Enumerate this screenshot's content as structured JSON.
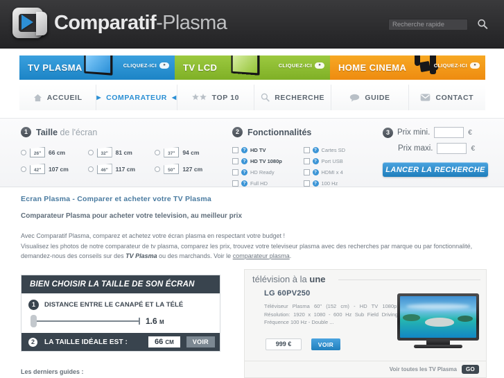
{
  "header": {
    "logo_primary": "Comparatif",
    "logo_secondary": "-Plasma",
    "logo_icon": "cp-play-logo",
    "search_placeholder": "Recherche rapide",
    "search_value": "",
    "search_icon": "search-icon"
  },
  "categories": [
    {
      "label": "TV PLASMA",
      "cta": "CLIQUEZ-ICI",
      "badge": "»",
      "color": "#2d90d5"
    },
    {
      "label": "TV LCD",
      "cta": "CLIQUEZ-ICI",
      "badge": "»",
      "color": "#8fbe31"
    },
    {
      "label": "HOME CINEMA",
      "cta": "CLIQUEZ-ICI",
      "badge": "»",
      "color": "#f29518"
    }
  ],
  "nav": [
    {
      "label": "ACCUEIL",
      "icon": "home-icon",
      "active": false
    },
    {
      "label": "COMPARATEUR",
      "icon": "arrows",
      "active": true
    },
    {
      "label": "TOP 10",
      "icon": "stars-icon",
      "active": false
    },
    {
      "label": "RECHERCHE",
      "icon": "search-icon",
      "active": false
    },
    {
      "label": "GUIDE",
      "icon": "speech-bubble-icon",
      "active": false
    },
    {
      "label": "CONTACT",
      "icon": "envelope-icon",
      "active": false
    }
  ],
  "filters": {
    "step1": {
      "number": "1",
      "title_bold": "Taille",
      "title_rest": " de l'écran",
      "sizes": [
        {
          "inches": "26ʺ",
          "cm": "66 cm"
        },
        {
          "inches": "32ʺ",
          "cm": "81 cm"
        },
        {
          "inches": "37ʺ",
          "cm": "94 cm"
        },
        {
          "inches": "42ʺ",
          "cm": "107 cm"
        },
        {
          "inches": "46ʺ",
          "cm": "117 cm"
        },
        {
          "inches": "50ʺ",
          "cm": "127 cm"
        }
      ]
    },
    "step2": {
      "number": "2",
      "title": "Fonctionnalités",
      "features": [
        {
          "label": "HD TV",
          "bold": true
        },
        {
          "label": "Cartes SD",
          "bold": false
        },
        {
          "label": "HD TV 1080p",
          "bold": true
        },
        {
          "label": "Port USB",
          "bold": false
        },
        {
          "label": "HD Ready",
          "bold": false
        },
        {
          "label": "HDMI x 4",
          "bold": false
        },
        {
          "label": "Full HD",
          "bold": false
        },
        {
          "label": "100 Hz",
          "bold": false
        }
      ]
    },
    "step3": {
      "number": "3",
      "min_label": "Prix mini.",
      "min_value": "",
      "max_label": "Prix maxi.",
      "max_value": "",
      "currency": "€",
      "submit_label": "LANCER LA RECHERCHE"
    }
  },
  "article": {
    "heading": "Ecran Plasma - Comparer et acheter votre TV Plasma",
    "subheading": "Comparateur Plasma pour acheter votre television, au meilleur prix",
    "p1": "Avec Comparatif Plasma, comparez et achetez votre écran plasma en respectant votre budget !",
    "p2_a": "Visualisez les photos de notre comparateur de tv plasma, comparez les prix, trouvez votre televiseur plasma avec des recherches par marque ou par fonctionnalité, demandez-nous des conseils sur des ",
    "p2_bold": "TV Plasma",
    "p2_b": " ou des marchands. Voir le ",
    "p2_link": "comparateur plasma",
    "p2_end": "."
  },
  "guide": {
    "title": "BIEN CHOISIR LA TAILLE DE SON ÉCRAN",
    "step1_num": "1",
    "step1_label": "DISTANCE ENTRE LE CANAPÉ ET LA TÉLÉ",
    "distance_value": "1.6",
    "distance_unit": "M",
    "step2_num": "2",
    "step2_label": "LA TAILLE IDÉALE EST :",
    "ideal_size": "66",
    "ideal_unit": "CM",
    "voir_label": "VOIR",
    "last_guides": "Les derniers guides :"
  },
  "product": {
    "panel_title_light": "télévision à la ",
    "panel_title_bold": "une",
    "name": "LG 60PV250",
    "description": "Téléviseur Plasma 60\" (152 cm) - HD TV 1080p - Résolution: 1920 x 1080 - 600 Hz Sub Field Driving - Fréquence 100 Hz - Double ...",
    "price": "999 €",
    "voir_label": "VOIR",
    "footer_label": "Voir toutes les TV Plasma",
    "go_label": "GO",
    "image_alt": "tv-plasma-photo"
  }
}
